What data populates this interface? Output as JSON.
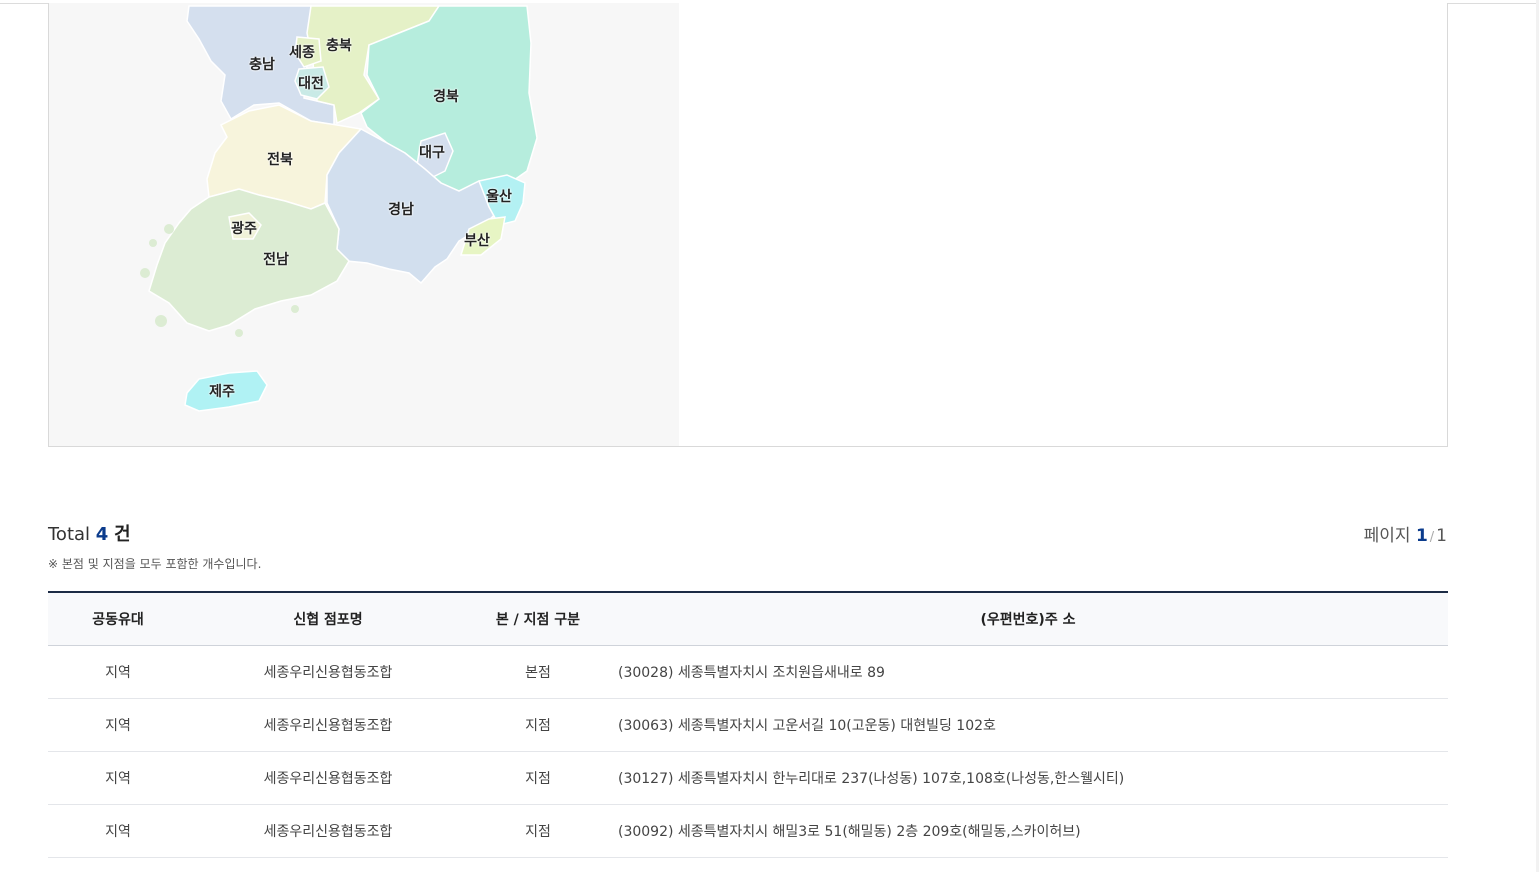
{
  "map": {
    "colors": {
      "chungnam": "#d4dfee",
      "chungbuk": "#e5f1c7",
      "gyeongbuk": "#b6eddd",
      "jeonbuk": "#f7f4dc",
      "gyeongnam": "#d2dfee",
      "jeonnam": "#dcecd3",
      "daegu": "#d4dfee",
      "ulsan": "#b3f1f3",
      "busan": "#e7f5c4",
      "jeju": "#b0f2f4",
      "sejong": "#e5f1c7",
      "daejeon": "#c9eae6",
      "gwangju": "#f0f2d8"
    },
    "regions": [
      {
        "key": "chungnam",
        "label": "충남"
      },
      {
        "key": "sejong",
        "label": "세종"
      },
      {
        "key": "chungbuk",
        "label": "충북"
      },
      {
        "key": "daejeon",
        "label": "대전"
      },
      {
        "key": "gyeongbuk",
        "label": "경북"
      },
      {
        "key": "jeonbuk",
        "label": "전북"
      },
      {
        "key": "daegu",
        "label": "대구"
      },
      {
        "key": "ulsan",
        "label": "울산"
      },
      {
        "key": "gyeongnam",
        "label": "경남"
      },
      {
        "key": "gwangju",
        "label": "광주"
      },
      {
        "key": "busan",
        "label": "부산"
      },
      {
        "key": "jeonnam",
        "label": "전남"
      },
      {
        "key": "jeju",
        "label": "제주"
      }
    ]
  },
  "summary": {
    "total_prefix": "Total",
    "total_count": "4",
    "total_unit": "건",
    "note": "※ 본점 및 지점을 모두 포함한 개수입니다.",
    "page_label": "페이지",
    "page_current": "1",
    "page_separator": "/",
    "page_total": "1"
  },
  "table": {
    "headers": [
      "공동유대",
      "신협 점포명",
      "본 / 지점 구분",
      "(우편번호)주 소"
    ],
    "rows": [
      {
        "bond": "지역",
        "name": "세종우리신용협동조합",
        "type": "본점",
        "address": "(30028) 세종특별자치시 조치원읍새내로 89"
      },
      {
        "bond": "지역",
        "name": "세종우리신용협동조합",
        "type": "지점",
        "address": "(30063) 세종특별자치시 고운서길 10(고운동) 대현빌딩 102호"
      },
      {
        "bond": "지역",
        "name": "세종우리신용협동조합",
        "type": "지점",
        "address": "(30127) 세종특별자치시 한누리대로 237(나성동) 107호,108호(나성동,한스웰시티)"
      },
      {
        "bond": "지역",
        "name": "세종우리신용협동조합",
        "type": "지점",
        "address": "(30092) 세종특별자치시 해밀3로 51(해밀동) 2층 209호(해밀동,스카이허브)"
      }
    ]
  }
}
